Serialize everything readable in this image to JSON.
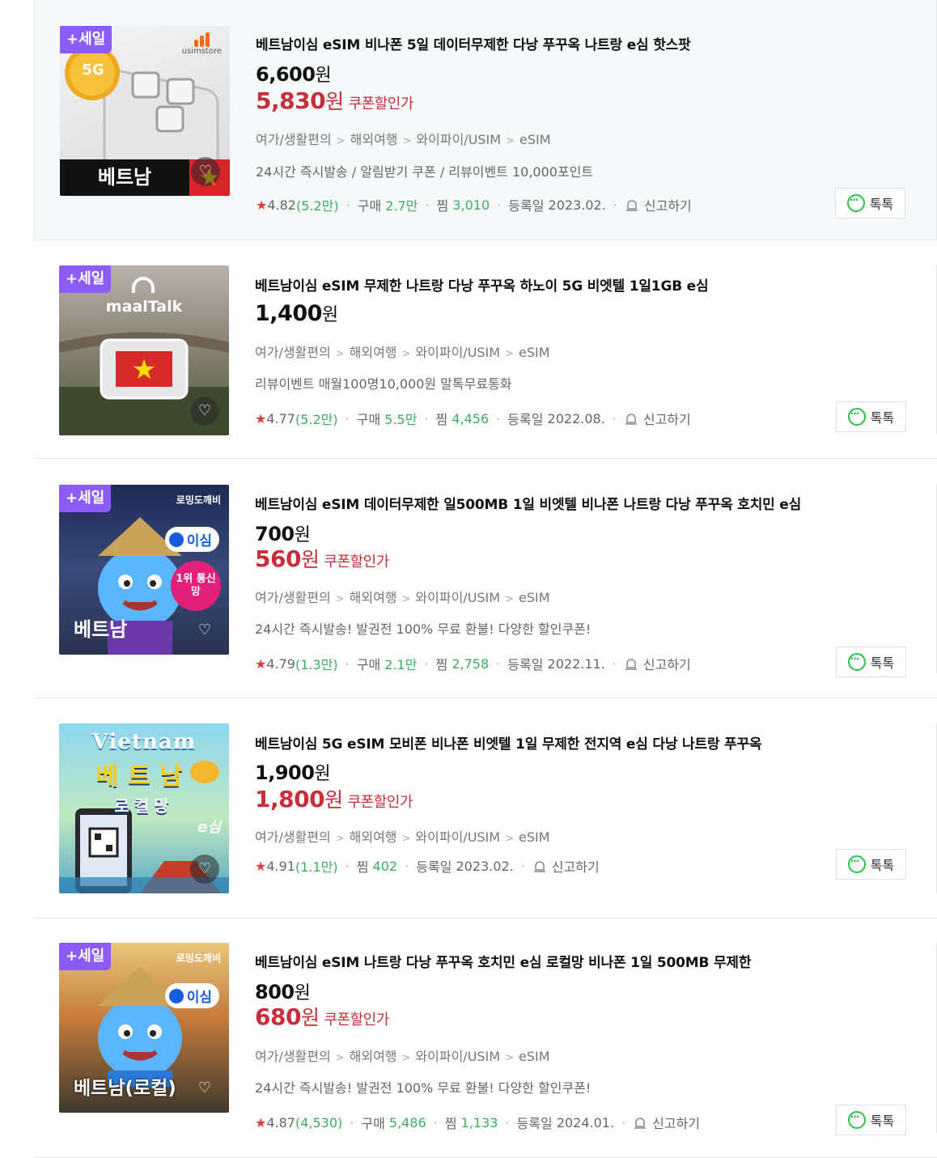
{
  "common": {
    "sale_badge": "+세일",
    "category": [
      "여가/생활편의",
      "와이파이/USIM",
      "eSIM"
    ],
    "category_mid": "해외여행",
    "buy_label": "구매",
    "zzim_label": "찜",
    "reg_label": "등록일",
    "report_label": "신고하기",
    "talk_label": "톡톡",
    "coupon_label": "쿠폰할인가",
    "won": "원",
    "star": "★"
  },
  "items": [
    {
      "title": "베트남이심 eSIM 비나폰 5일 데이터무제한 다낭 푸꾸옥 나트랑 e심 핫스팟",
      "price": "6,600",
      "sale_price": "5,830",
      "promo": "24시간 즉시발송 / 알림받기 쿠폰 / 리뷰이벤트 10,000포인트",
      "rating": "4.82",
      "reviews": "(5.2만)",
      "buy": "2.7만",
      "zzim": "3,010",
      "reg": "2023.02.",
      "thumb_brand": "usimstore",
      "thumb_badge": "5G",
      "thumb_caption": "베트남"
    },
    {
      "title": "베트남이심 eSIM 무제한 나트랑 다낭 푸꾸옥 하노이 5G 비엣텔 1일1GB e심",
      "price": "1,400",
      "promo": "리뷰이벤트 매월100명10,000원 말톡무료통화",
      "rating": "4.77",
      "reviews": "(5.2만)",
      "buy": "5.5만",
      "zzim": "4,456",
      "reg": "2022.08.",
      "thumb_brand": "maalTalk"
    },
    {
      "title": "베트남이심 eSIM 데이터무제한 일500MB 1일 비엣텔 비나폰 나트랑 다낭 푸꾸옥 호치민 e심",
      "price": "700",
      "sale_price": "560",
      "promo": "24시간 즉시발송! 발권전 100% 무료 환불! 다양한 할인쿠폰!",
      "rating": "4.79",
      "reviews": "(1.3만)",
      "buy": "2.1만",
      "zzim": "2,758",
      "reg": "2022.11.",
      "thumb_brand": "로밍도깨비",
      "thumb_pill": "이심",
      "thumb_rank": "1위 통신망",
      "thumb_caption": "베트남"
    },
    {
      "title": "베트남이심 5G eSIM 모비폰 비나폰 비엣텔 1일 무제한 전지역 e심 다낭 나트랑 푸꾸옥",
      "price": "1,900",
      "sale_price": "1,800",
      "rating": "4.91",
      "reviews": "(1.1만)",
      "zzim": "402",
      "reg": "2023.02.",
      "thumb_en": "Vietnam",
      "thumb_ko": "베트남",
      "thumb_sub": "로컬망",
      "thumb_e": "e심"
    },
    {
      "title": "베트남이심 eSIM 나트랑 다낭 푸꾸옥 호치민 e심 로컬망 비나폰 1일 500MB 무제한",
      "price": "800",
      "sale_price": "680",
      "promo": "24시간 즉시발송! 발권전 100% 무료 환불! 다양한 할인쿠폰!",
      "rating": "4.87",
      "reviews": "(4,530)",
      "buy": "5,486",
      "zzim": "1,133",
      "reg": "2024.01.",
      "thumb_brand": "로밍도깨비",
      "thumb_pill": "이심",
      "thumb_caption": "베트남(로컬)"
    }
  ]
}
